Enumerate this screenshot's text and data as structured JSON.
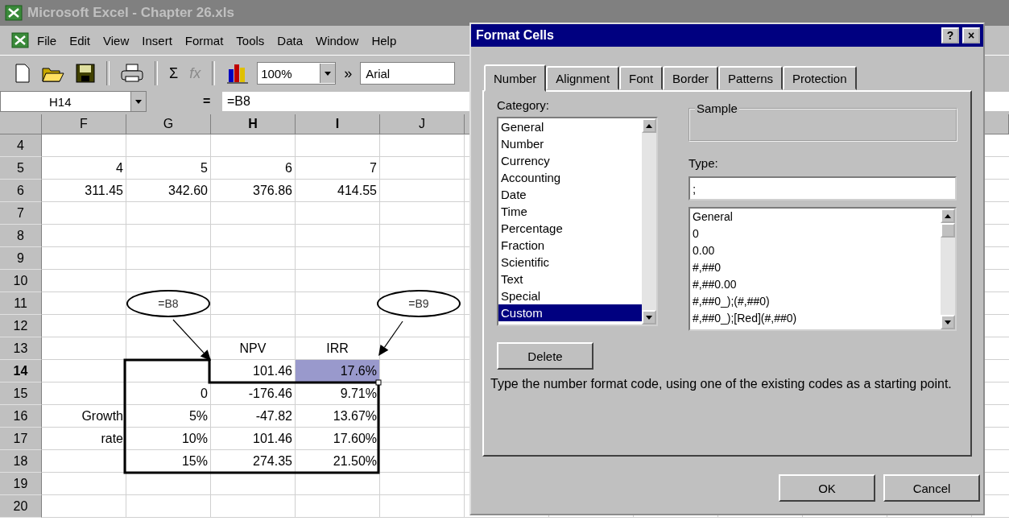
{
  "window": {
    "title": "Microsoft Excel - Chapter 26.xls"
  },
  "menu": [
    "File",
    "Edit",
    "View",
    "Insert",
    "Format",
    "Tools",
    "Data",
    "Window",
    "Help"
  ],
  "toolbar": [
    {
      "kind": "new"
    },
    {
      "kind": "open"
    },
    {
      "kind": "save"
    },
    {
      "kind": "separator"
    },
    {
      "kind": "print"
    },
    {
      "kind": "separator"
    },
    {
      "kind": "text",
      "label": "Σ",
      "disabled": false
    },
    {
      "kind": "text",
      "label": "fx",
      "disabled": true
    },
    {
      "kind": "separator"
    },
    {
      "kind": "chart"
    },
    {
      "kind": "combo",
      "value": "100%"
    },
    {
      "kind": "text",
      "label": "»",
      "disabled": false
    },
    {
      "kind": "field",
      "value": "Arial"
    }
  ],
  "formula_bar": {
    "name_box": "H14",
    "equals": "=",
    "formula": "=B8"
  },
  "columns": [
    {
      "label": "F",
      "selected": false
    },
    {
      "label": "G",
      "selected": false
    },
    {
      "label": "H",
      "selected": true
    },
    {
      "label": "I",
      "selected": true
    },
    {
      "label": "J",
      "selected": false
    }
  ],
  "rows": [
    {
      "label": "4",
      "selected": false,
      "kind": "values",
      "cells": [
        null,
        null,
        null,
        null,
        null
      ]
    },
    {
      "label": "5",
      "selected": false,
      "kind": "values",
      "cells": [
        "4",
        "5",
        "6",
        "7",
        null
      ]
    },
    {
      "label": "6",
      "selected": false,
      "kind": "values",
      "cells": [
        "311.45",
        "342.60",
        "376.86",
        "414.55",
        null
      ]
    },
    {
      "label": "7",
      "selected": false,
      "kind": "values",
      "cells": [
        null,
        null,
        null,
        null,
        null
      ]
    },
    {
      "label": "8",
      "selected": false,
      "kind": "values",
      "cells": [
        null,
        null,
        null,
        null,
        null
      ]
    },
    {
      "label": "9",
      "selected": false,
      "kind": "values",
      "cells": [
        null,
        null,
        null,
        null,
        null
      ]
    },
    {
      "label": "10",
      "selected": false,
      "kind": "values",
      "cells": [
        null,
        null,
        null,
        null,
        null
      ]
    },
    {
      "label": "11",
      "selected": false,
      "kind": "values",
      "cells": [
        null,
        null,
        null,
        null,
        null
      ]
    },
    {
      "label": "12",
      "selected": false,
      "kind": "values",
      "cells": [
        null,
        null,
        null,
        null,
        null
      ]
    },
    {
      "label": "13",
      "selected": false,
      "kind": "labels",
      "cells": [
        null,
        null,
        "NPV",
        "IRR",
        null
      ]
    },
    {
      "label": "14",
      "selected": true,
      "kind": "values",
      "cells": [
        null,
        null,
        "101.46",
        {
          "text": "17.6%",
          "highlighted": true
        },
        null
      ]
    },
    {
      "label": "15",
      "selected": false,
      "kind": "values",
      "cells": [
        null,
        "0",
        "-176.46",
        "9.71%",
        null
      ]
    },
    {
      "label": "16",
      "selected": false,
      "kind": "values",
      "cells": [
        "Growth",
        "5%",
        "-47.82",
        "13.67%",
        null
      ]
    },
    {
      "label": "17",
      "selected": false,
      "kind": "values",
      "cells": [
        "rate",
        "10%",
        "101.46",
        "17.60%",
        null
      ]
    },
    {
      "label": "18",
      "selected": false,
      "kind": "values",
      "cells": [
        null,
        "15%",
        "274.35",
        "21.50%",
        null
      ]
    },
    {
      "label": "19",
      "selected": false,
      "kind": "values",
      "cells": [
        null,
        null,
        null,
        null,
        null
      ]
    },
    {
      "label": "20",
      "selected": false,
      "kind": "values",
      "cells": [
        null,
        null,
        null,
        null,
        null
      ]
    }
  ],
  "callouts": [
    {
      "text": "=B8"
    },
    {
      "text": "=B9"
    }
  ],
  "dialog": {
    "title": "Format Cells",
    "title_buttons": [
      "?",
      "×"
    ],
    "tabs": [
      {
        "label": "Number",
        "selected": true
      },
      {
        "label": "Alignment",
        "selected": false
      },
      {
        "label": "Font",
        "selected": false
      },
      {
        "label": "Border",
        "selected": false
      },
      {
        "label": "Patterns",
        "selected": false
      },
      {
        "label": "Protection",
        "selected": false
      }
    ],
    "category_label": "Category:",
    "categories": [
      {
        "label": "General",
        "selected": false
      },
      {
        "label": "Number",
        "selected": false
      },
      {
        "label": "Currency",
        "selected": false
      },
      {
        "label": "Accounting",
        "selected": false
      },
      {
        "label": "Date",
        "selected": false
      },
      {
        "label": "Time",
        "selected": false
      },
      {
        "label": "Percentage",
        "selected": false
      },
      {
        "label": "Fraction",
        "selected": false
      },
      {
        "label": "Scientific",
        "selected": false
      },
      {
        "label": "Text",
        "selected": false
      },
      {
        "label": "Special",
        "selected": false
      },
      {
        "label": "Custom",
        "selected": true
      }
    ],
    "sample_label": "Sample",
    "type_label": "Type:",
    "type_value": ";",
    "type_list": [
      "General",
      "0",
      "0.00",
      "#,##0",
      "#,##0.00",
      "#,##0_);(#,##0)",
      "#,##0_);[Red](#,##0)"
    ],
    "delete_button": "Delete",
    "hint": "Type the number format code, using one of the existing codes as a starting point.",
    "buttons": [
      "OK",
      "Cancel"
    ]
  }
}
